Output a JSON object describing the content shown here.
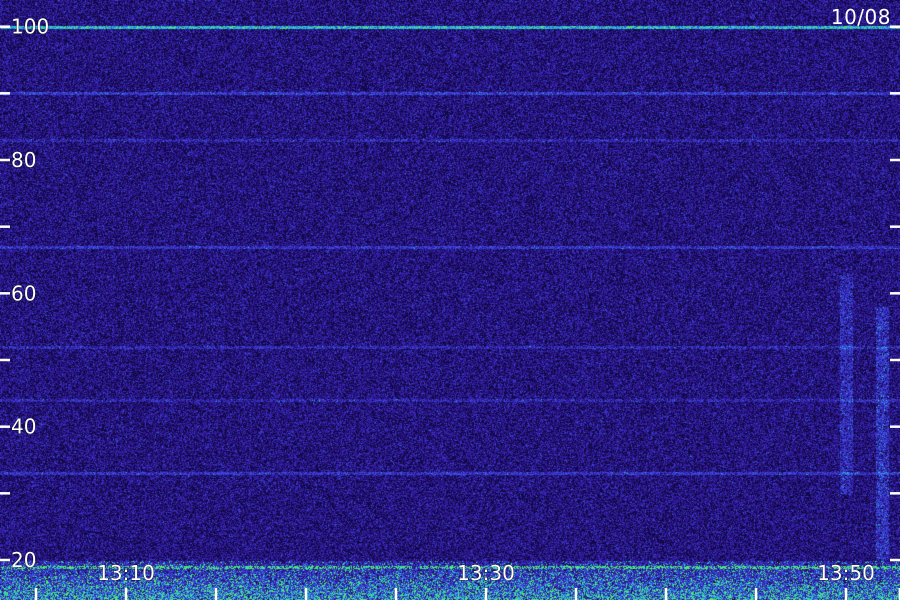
{
  "chart_data": {
    "type": "heatmap",
    "title": "10/08",
    "xlabel": "",
    "ylabel": "",
    "ylim": [
      14,
      104
    ],
    "y_ticks_labeled": [
      20,
      40,
      60,
      80,
      100
    ],
    "y_ticks_minor": [
      30,
      50,
      70,
      90
    ],
    "x_range": [
      "13:03",
      "13:53"
    ],
    "x_ticks_labeled": [
      "13:10",
      "13:30",
      "13:50"
    ],
    "x_ticks_minor": [
      "13:05",
      "13:15",
      "13:20",
      "13:25",
      "13:35",
      "13:40",
      "13:45",
      "13:53"
    ],
    "colors": {
      "background": "#1c1060",
      "noise_low": "#2a1a90",
      "noise_high": "#4a3fd0",
      "strong": "#29d6c8",
      "peak": "#5cff6a",
      "labels": "#ffffff"
    },
    "features": [
      {
        "type": "horizontal_line",
        "y": 100,
        "color": "#3a8bff",
        "strength": 0.9
      },
      {
        "type": "horizontal_line",
        "y": 90,
        "color": "#4a5cff",
        "strength": 0.35
      },
      {
        "type": "horizontal_line",
        "y": 83,
        "color": "#4a4cff",
        "strength": 0.2
      },
      {
        "type": "horizontal_line",
        "y": 67,
        "color": "#4a4cff",
        "strength": 0.3
      },
      {
        "type": "horizontal_line",
        "y": 52,
        "color": "#4a4cff",
        "strength": 0.2
      },
      {
        "type": "horizontal_line",
        "y": 44,
        "color": "#4a4cff",
        "strength": 0.2
      },
      {
        "type": "horizontal_line",
        "y": 33,
        "color": "#4a5cff",
        "strength": 0.3
      },
      {
        "type": "vertical_band",
        "x": "13:50",
        "y_range": [
          30,
          63
        ],
        "strength": 0.5
      },
      {
        "type": "vertical_band",
        "x": "13:52",
        "y_range": [
          20,
          58
        ],
        "strength": 0.6
      },
      {
        "type": "low_band_activity",
        "y_range": [
          14,
          20
        ],
        "peak_line_y": 19
      }
    ]
  }
}
